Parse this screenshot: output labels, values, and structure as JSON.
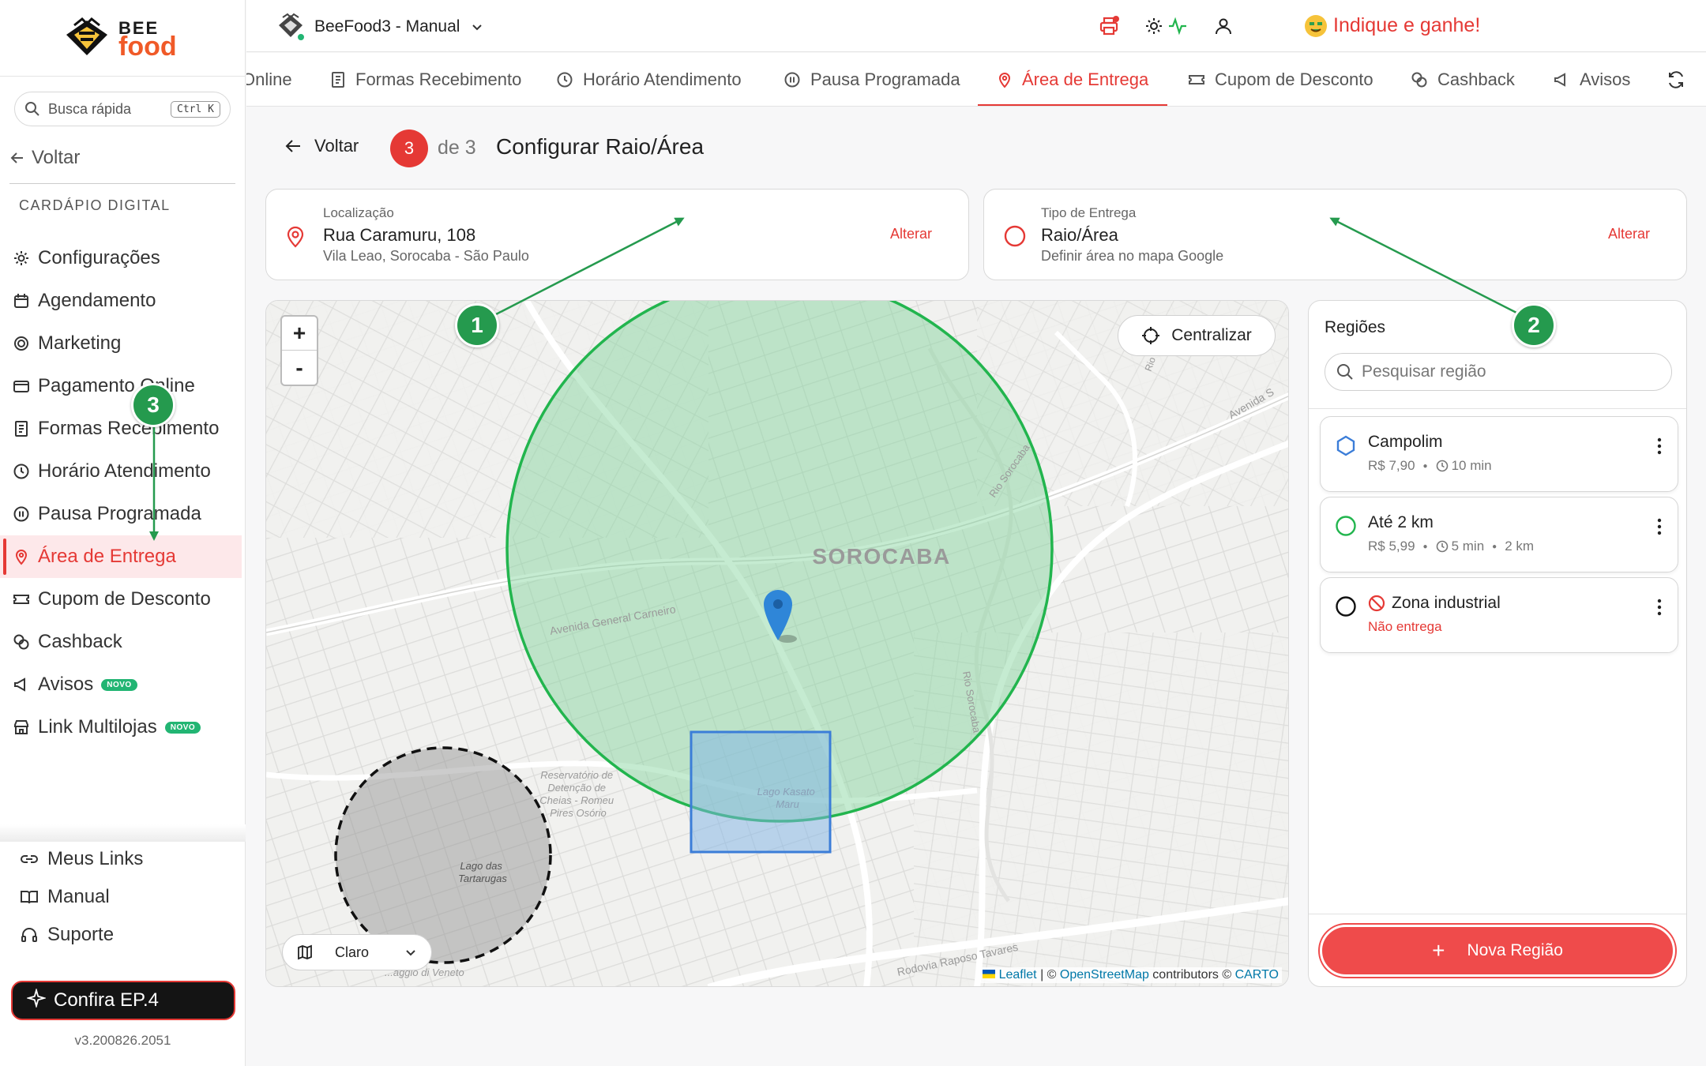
{
  "sidebar": {
    "logo_bee": "BEE",
    "logo_food": "food",
    "search_placeholder": "Busca rápida",
    "search_shortcut": "Ctrl K",
    "back": "Voltar",
    "section": "CARDÁPIO DIGITAL",
    "items": [
      {
        "label": "Configurações",
        "icon": "gear-icon"
      },
      {
        "label": "Agendamento",
        "icon": "calendar-icon"
      },
      {
        "label": "Marketing",
        "icon": "target-icon"
      },
      {
        "label": "Pagamento Online",
        "icon": "card-icon"
      },
      {
        "label": "Formas Recebimento",
        "icon": "receipt-icon"
      },
      {
        "label": "Horário Atendimento",
        "icon": "clock-icon"
      },
      {
        "label": "Pausa Programada",
        "icon": "pause-icon"
      },
      {
        "label": "Área de Entrega",
        "icon": "map-pin-icon",
        "active": true
      },
      {
        "label": "Cupom de Desconto",
        "icon": "ticket-icon"
      },
      {
        "label": "Cashback",
        "icon": "coins-icon"
      },
      {
        "label": "Avisos",
        "icon": "megaphone-icon",
        "badge": "NOVO"
      },
      {
        "label": "Link Multilojas",
        "icon": "store-icon",
        "badge": "NOVO"
      }
    ],
    "bottom": [
      {
        "label": "Meus Links",
        "icon": "link-icon"
      },
      {
        "label": "Manual",
        "icon": "book-icon"
      },
      {
        "label": "Suporte",
        "icon": "headset-icon"
      }
    ],
    "cta": "Confira EP.4",
    "version": "v3.200826.2051"
  },
  "header": {
    "store": "BeeFood3 - Manual",
    "indique": "Indique e ganhe!"
  },
  "tabs": [
    {
      "label": "Online",
      "icon": ""
    },
    {
      "label": "Formas Recebimento",
      "icon": "receipt-icon"
    },
    {
      "label": "Horário Atendimento",
      "icon": "clock-icon"
    },
    {
      "label": "Pausa Programada",
      "icon": "pause-icon"
    },
    {
      "label": "Área de Entrega",
      "icon": "map-pin-icon",
      "active": true
    },
    {
      "label": "Cupom de Desconto",
      "icon": "ticket-icon"
    },
    {
      "label": "Cashback",
      "icon": "coins-icon"
    },
    {
      "label": "Avisos",
      "icon": "megaphone-icon"
    }
  ],
  "page": {
    "back": "Voltar",
    "step": "3",
    "step_of": "de 3",
    "title": "Configurar Raio/Área"
  },
  "location_card": {
    "label": "Localização",
    "value": "Rua Caramuru, 108",
    "sub": "Vila Leao, Sorocaba - São Paulo",
    "action": "Alterar"
  },
  "delivery_card": {
    "label": "Tipo de Entrega",
    "value": "Raio/Área",
    "sub": "Definir área no mapa Google",
    "action": "Alterar"
  },
  "map": {
    "zoom_in": "+",
    "zoom_out": "-",
    "center_button": "Centralizar",
    "style_select": "Claro",
    "city_label": "SOROCABA",
    "street_labels": [
      "Avenida General Carneiro",
      "Reservatório de Detenção de Cheias - Romeu Pires Osório",
      "Lago Kasato Maru",
      "Lago das Tartarugas",
      "Rodovia Raposo Tavares",
      "Avenida S",
      "Rio Sorocaba",
      "Rio Sorocaba",
      "Rio",
      "...aggio di Veneto"
    ],
    "attribution_leaflet": "Leaflet",
    "attribution_osm": "OpenStreetMap",
    "attribution_carto": "CARTO",
    "attribution_sep1": " | © ",
    "attribution_sep2": " contributors © "
  },
  "regions": {
    "title": "Regiões",
    "search_placeholder": "Pesquisar região",
    "items": [
      {
        "name": "Campolim",
        "price": "R$ 7,90",
        "time": "10 min",
        "distance": "",
        "shape": "polygon",
        "color": "#3b7dd8"
      },
      {
        "name": "Até 2 km",
        "price": "R$ 5,99",
        "time": "5 min",
        "distance": "2 km",
        "shape": "circle",
        "color": "#22b54e"
      },
      {
        "name": "Zona industrial",
        "status": "Não entrega",
        "shape": "circle",
        "color": "#111111"
      }
    ],
    "new_button": "Nova Região"
  },
  "annotations": [
    "1",
    "2",
    "3"
  ],
  "colors": {
    "accent": "#e53935",
    "annotation": "#259a4e",
    "zone_green": "#22b54e",
    "zone_blue": "#3b7dd8"
  }
}
